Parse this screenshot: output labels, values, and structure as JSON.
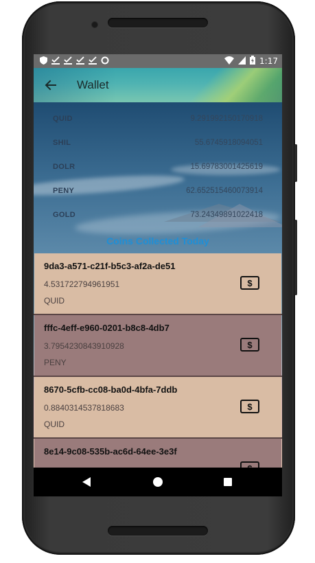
{
  "status_bar": {
    "time": "1:17",
    "left_icons": [
      "shield-icon",
      "download-check-icon",
      "download-check-icon",
      "download-check-icon",
      "download-check-icon",
      "circle-icon"
    ],
    "right_icons": [
      "wifi-icon",
      "cellular-signal-icon",
      "battery-charging-icon"
    ]
  },
  "appbar": {
    "title": "Wallet",
    "back_icon": "arrow-back-icon"
  },
  "balances": [
    {
      "currency": "QUID",
      "amount": "9.291992150170918"
    },
    {
      "currency": "SHIL",
      "amount": "55.6745918094051"
    },
    {
      "currency": "DOLR",
      "amount": "15.69783001425619"
    },
    {
      "currency": "PENY",
      "amount": "62.652515460073914"
    },
    {
      "currency": "GOLD",
      "amount": "73.24349891022418"
    }
  ],
  "section_title": "Coins Collected Today",
  "coins": [
    {
      "id": "9da3-a571-c21f-b5c3-af2a-de51",
      "amount": "4.531722794961951",
      "currency": "QUID",
      "button_icon": "dollar-bill-icon",
      "button_glyph": "$",
      "shade": "light"
    },
    {
      "id": "fffc-4eff-e960-0201-b8c8-4db7",
      "amount": "3.7954230843910928",
      "currency": "PENY",
      "button_icon": "dollar-bill-icon",
      "button_glyph": "$",
      "shade": "dark"
    },
    {
      "id": "8670-5cfb-cc08-ba0d-4bfa-7ddb",
      "amount": "0.8840314537818683",
      "currency": "QUID",
      "button_icon": "dollar-bill-icon",
      "button_glyph": "$",
      "shade": "light"
    },
    {
      "id": "8e14-9c08-535b-ac6d-64ee-3e3f",
      "amount": "",
      "currency": "",
      "button_icon": "dollar-bill-icon",
      "button_glyph": "$",
      "shade": "dark"
    }
  ],
  "nav_bar": {
    "icons": [
      "nav-back-icon",
      "nav-home-icon",
      "nav-recents-icon"
    ]
  },
  "colors": {
    "section_title": "#1f8fd6",
    "item_light": "#d9bca4",
    "item_dark": "#9a7b7b",
    "status_bar": "#6b6b6b"
  }
}
